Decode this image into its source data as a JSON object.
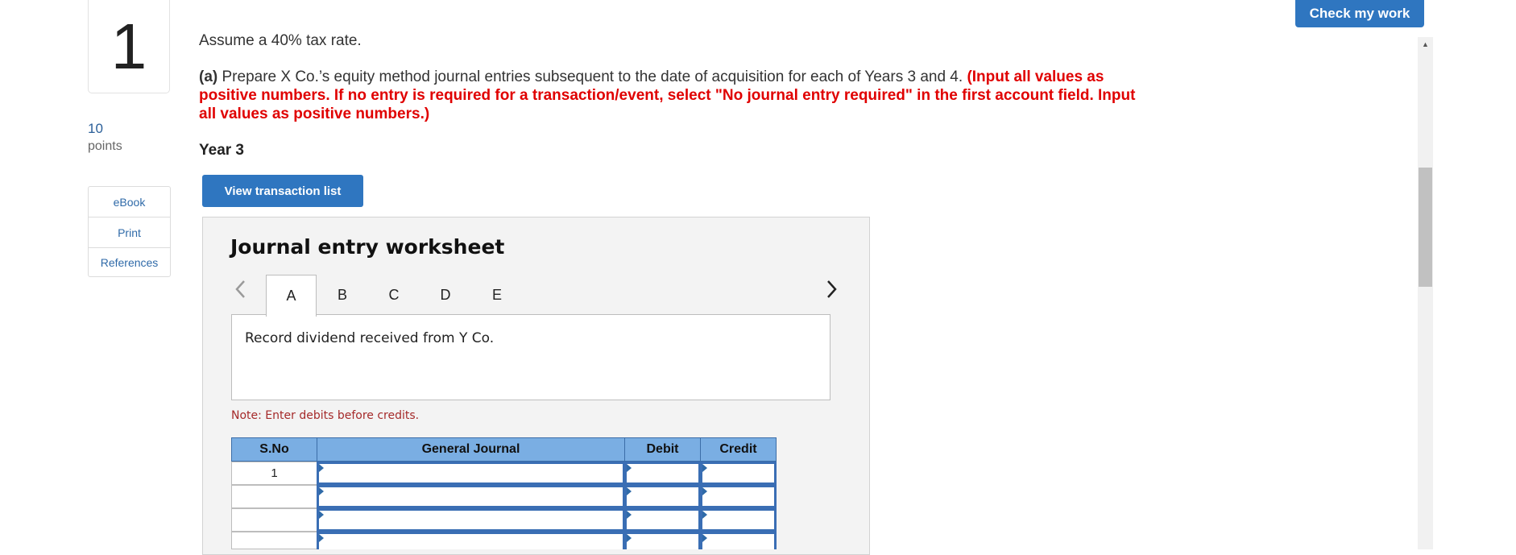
{
  "question": {
    "number": "1",
    "points_value": "10",
    "points_label": "points",
    "intro": "Assume a 40% tax rate.",
    "part_label": "(a)",
    "part_text": " Prepare X Co.’s equity method journal entries subsequent to the date of acquisition for each of Years 3 and 4. ",
    "instructions": "(Input all values as positive numbers. If no entry is required for a transaction/event, select \"No journal entry required\" in the first account field. Input all values as positive numbers.)",
    "year_label": "Year 3"
  },
  "sidebar": {
    "links": [
      {
        "label": "eBook"
      },
      {
        "label": "Print"
      },
      {
        "label": "References"
      }
    ]
  },
  "header": {
    "check_button": "Check my work"
  },
  "main": {
    "view_button": "View transaction list"
  },
  "worksheet": {
    "title": "Journal entry worksheet",
    "tabs": [
      {
        "label": "A",
        "active": true
      },
      {
        "label": "B"
      },
      {
        "label": "C"
      },
      {
        "label": "D"
      },
      {
        "label": "E"
      }
    ],
    "description": "Record dividend received from Y Co.",
    "note": "Note: Enter debits before credits.",
    "table": {
      "headers": [
        "S.No",
        "General Journal",
        "Debit",
        "Credit"
      ],
      "rows": [
        {
          "sno": "1",
          "account": "",
          "debit": "",
          "credit": ""
        },
        {
          "sno": "",
          "account": "",
          "debit": "",
          "credit": ""
        },
        {
          "sno": "",
          "account": "",
          "debit": "",
          "credit": ""
        },
        {
          "sno": "",
          "account": "",
          "debit": "",
          "credit": ""
        }
      ]
    }
  },
  "colors": {
    "accent": "#2f76c0",
    "instruction_red": "#e00000",
    "table_header": "#7aaee3"
  }
}
